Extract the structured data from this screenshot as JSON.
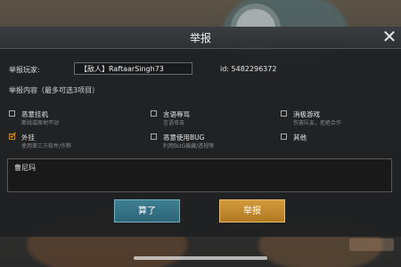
{
  "dialog": {
    "title": "举报",
    "close_glyph": "✕"
  },
  "player": {
    "label": "举报玩家:",
    "name": "【敌人】RaftaarSingh73",
    "id_text": "id: 5482296372"
  },
  "content": {
    "label": "举报内容（最多可选3项目）"
  },
  "options": [
    {
      "title": "恶意挂机",
      "subtitle": "断线或原地不动",
      "checked": false
    },
    {
      "title": "言语辱骂",
      "subtitle": "言语攻击",
      "checked": false
    },
    {
      "title": "消极游戏",
      "subtitle": "伤害队友，拒绝合作",
      "checked": false
    },
    {
      "title": "外挂",
      "subtitle": "使用第三方软件/作弊",
      "checked": true
    },
    {
      "title": "恶意使用BUG",
      "subtitle": "利用BUG躲藏/透视等",
      "checked": false
    },
    {
      "title": "其他",
      "subtitle": "",
      "checked": false
    }
  ],
  "textarea": {
    "value": "曹尼玛"
  },
  "buttons": {
    "cancel_label": "算了",
    "report_label": "举报"
  },
  "colors": {
    "accent_orange": "#d39a3c",
    "accent_teal": "#3f7f93"
  }
}
